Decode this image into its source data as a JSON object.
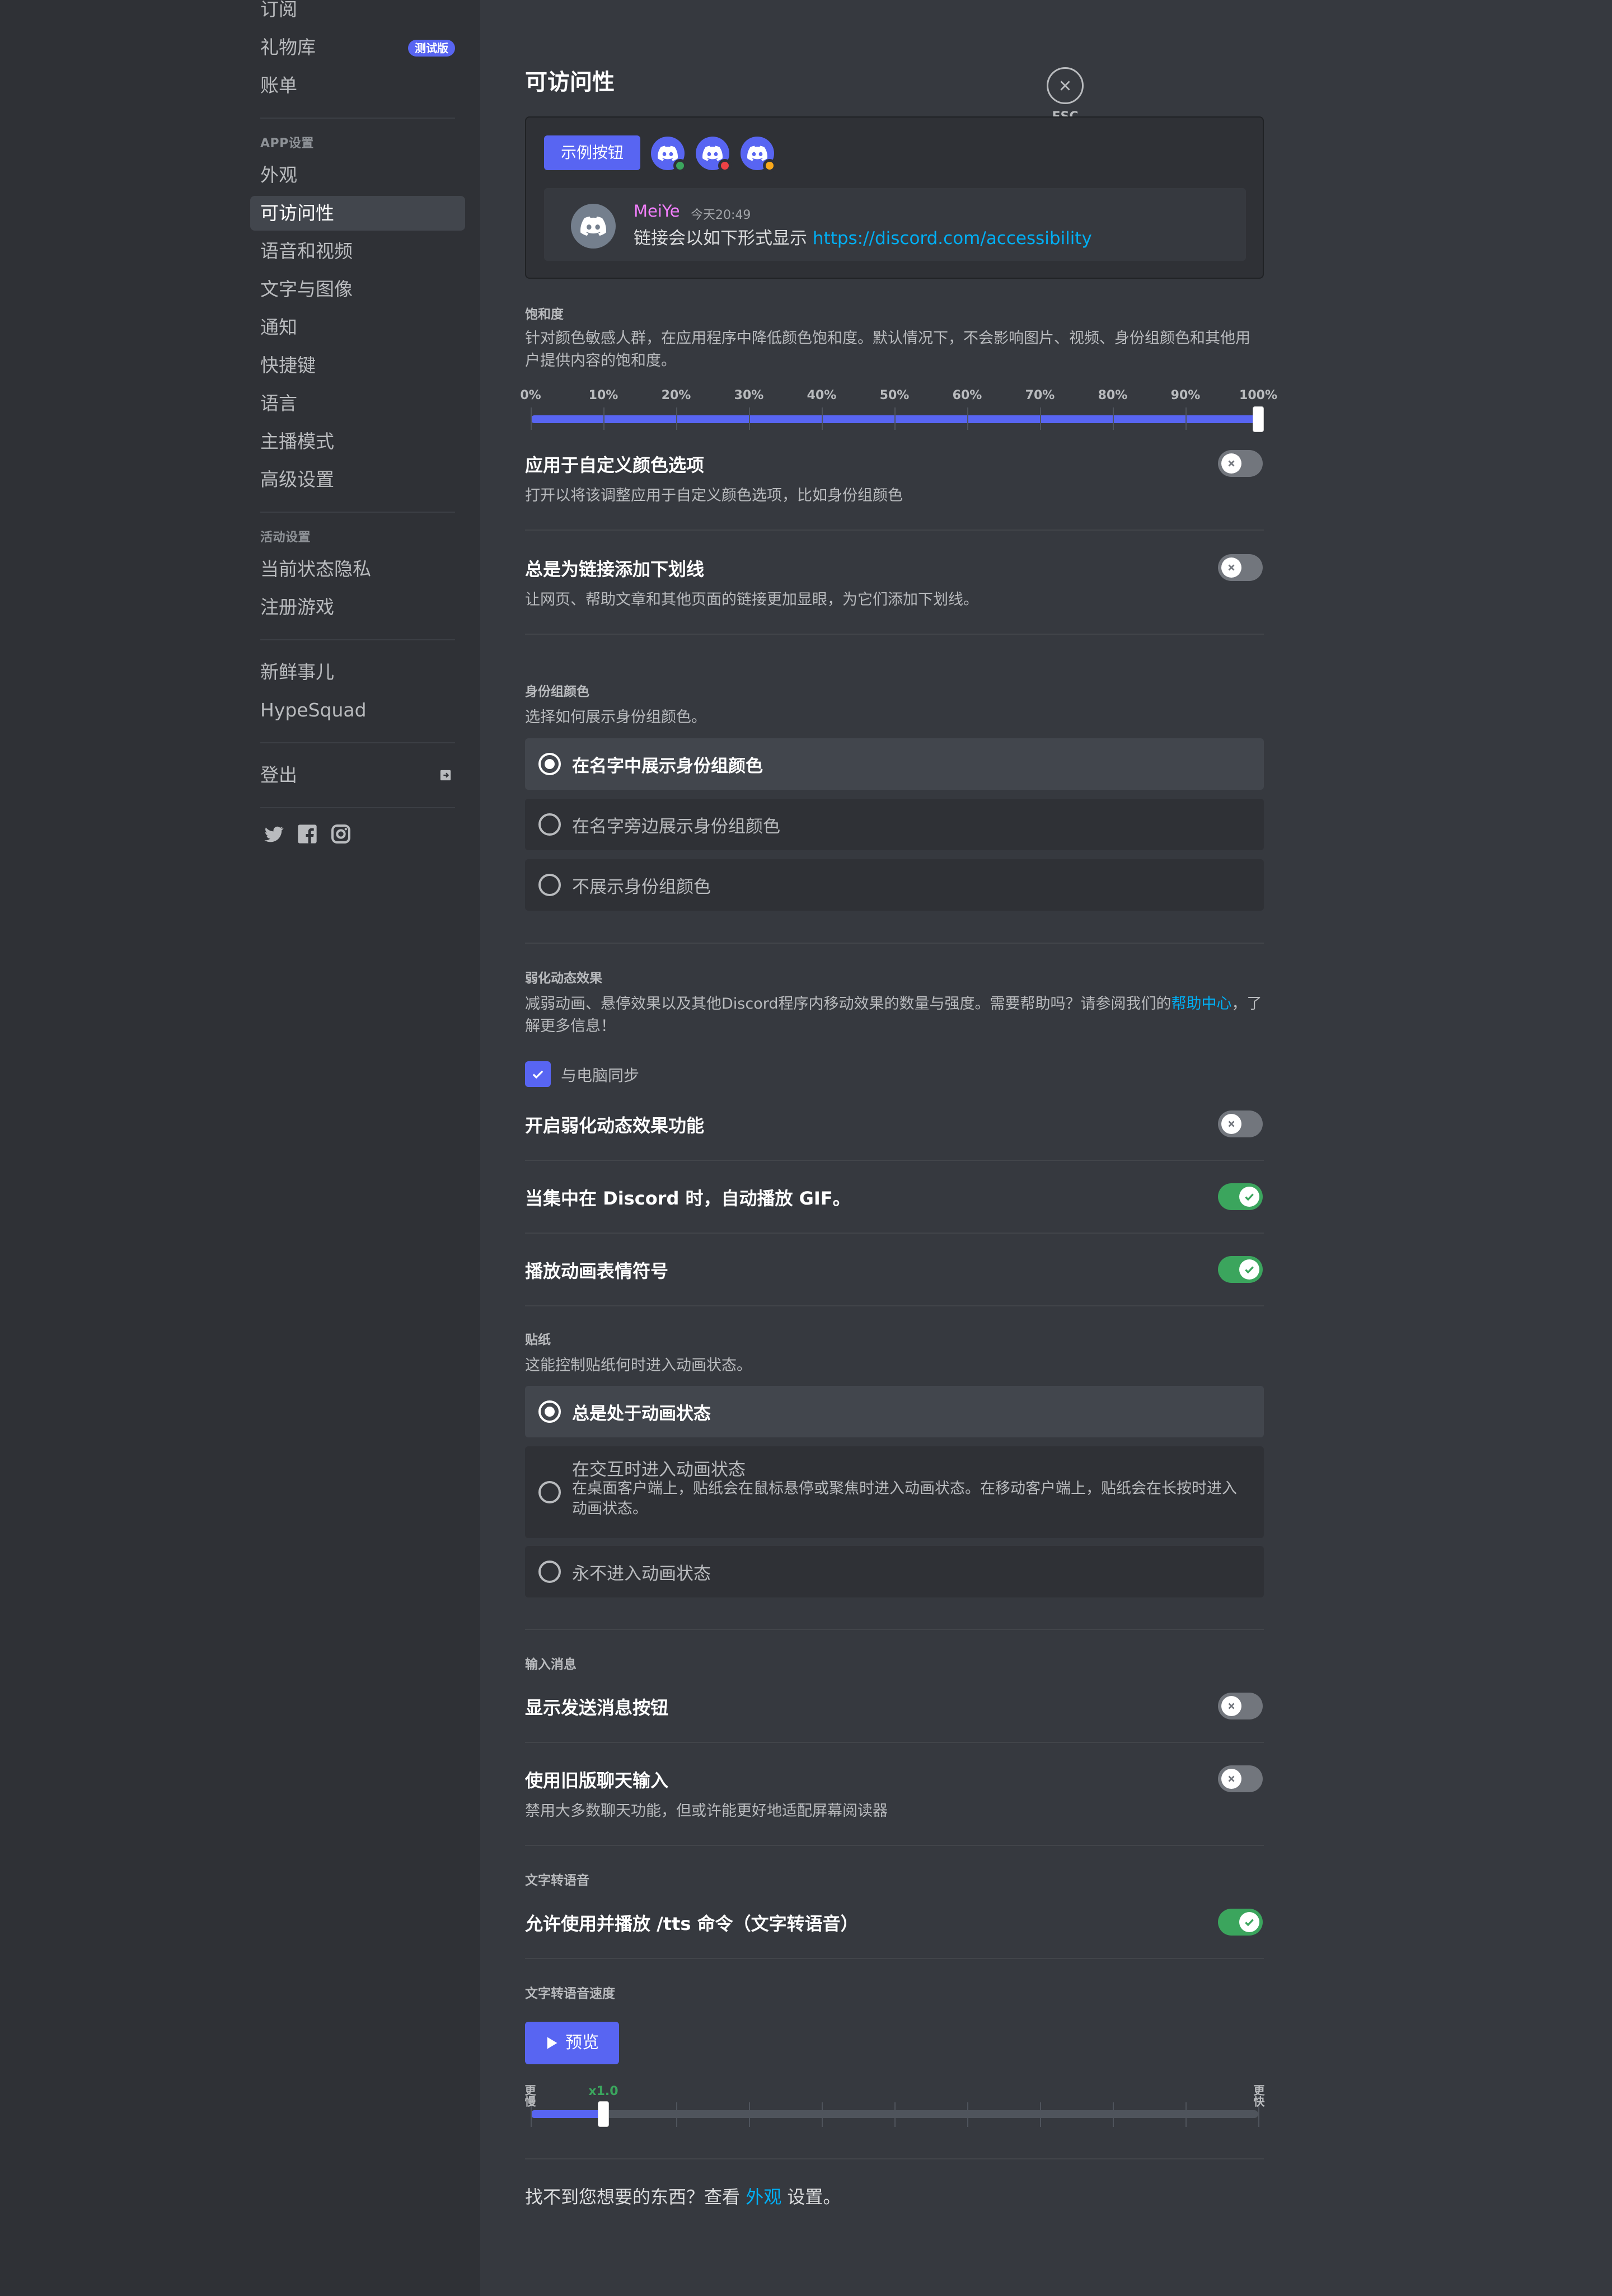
{
  "sidebar": {
    "items_top": [
      {
        "label": "订阅"
      },
      {
        "label": "礼物库",
        "badge": "测试版"
      },
      {
        "label": "账单"
      }
    ],
    "app_settings_header": "APP设置",
    "app_items": [
      {
        "label": "外观"
      },
      {
        "label": "可访问性",
        "active": true
      },
      {
        "label": "语音和视频"
      },
      {
        "label": "文字与图像"
      },
      {
        "label": "通知"
      },
      {
        "label": "快捷键"
      },
      {
        "label": "语言"
      },
      {
        "label": "主播模式"
      },
      {
        "label": "高级设置"
      }
    ],
    "activity_header": "活动设置",
    "activity_items": [
      {
        "label": "当前状态隐私"
      },
      {
        "label": "注册游戏"
      }
    ],
    "misc_items": [
      {
        "label": "新鲜事儿"
      },
      {
        "label": "HypeSquad"
      }
    ],
    "logout_label": "登出",
    "socials": [
      "twitter-icon",
      "facebook-icon",
      "instagram-icon"
    ]
  },
  "header": {
    "title": "可访问性",
    "esc_label": "ESC"
  },
  "preview": {
    "demo_button": "示例按钮",
    "avatars": [
      {
        "status": "online",
        "color": "#3ba55d"
      },
      {
        "status": "dnd",
        "color": "#ed4245"
      },
      {
        "status": "idle",
        "color": "#faa81a"
      }
    ],
    "message": {
      "name": "MeiYe",
      "time": "今天20:49",
      "text": "链接会以如下形式显示 ",
      "link": "https://discord.com/accessibility"
    }
  },
  "saturation": {
    "label": "饱和度",
    "description": "针对颜色敏感人群，在应用程序中降低颜色饱和度。默认情况下，不会影响图片、视频、身份组颜色和其他用户提供内容的饱和度。",
    "ticks": [
      "0%",
      "10%",
      "20%",
      "30%",
      "40%",
      "50%",
      "60%",
      "70%",
      "80%",
      "90%",
      "100%"
    ],
    "value": 1.0
  },
  "custom_colors": {
    "title": "应用于自定义颜色选项",
    "description": "打开以将该调整应用于自定义颜色选项，比如身份组颜色",
    "enabled": false
  },
  "underline_links": {
    "title": "总是为链接添加下划线",
    "description": "让网页、帮助文章和其他页面的链接更加显眼，为它们添加下划线。",
    "enabled": false
  },
  "role_colors": {
    "label": "身份组颜色",
    "description": "选择如何展示身份组颜色。",
    "options": [
      {
        "label": "在名字中展示身份组颜色",
        "selected": true
      },
      {
        "label": "在名字旁边展示身份组颜色",
        "selected": false
      },
      {
        "label": "不展示身份组颜色",
        "selected": false
      }
    ]
  },
  "reduced_motion": {
    "label": "弱化动态效果",
    "description": "减弱动画、悬停效果以及其他Discord程序内移动效果的数量与强度。需要帮助吗？请参阅我们的",
    "help_link": "帮助中心",
    "description_end": "，了解更多信息！",
    "sync_label": "与电脑同步",
    "sync_checked": true,
    "enable_title": "开启弱化动态效果功能",
    "enable_value": false,
    "gif_title": "当集中在 Discord 时，自动播放 GIF。",
    "gif_value": true,
    "emoji_title": "播放动画表情符号",
    "emoji_value": true
  },
  "stickers": {
    "label": "贴纸",
    "description": "这能控制贴纸何时进入动画状态。",
    "options": [
      {
        "label": "总是处于动画状态",
        "selected": true
      },
      {
        "label": "在交互时进入动画状态",
        "sub": "在桌面客户端上，贴纸会在鼠标悬停或聚焦时进入动画状态。在移动客户端上，贴纸会在长按时进入动画状态。",
        "selected": false
      },
      {
        "label": "永不进入动画状态",
        "selected": false
      }
    ]
  },
  "chat_input": {
    "label": "输入消息",
    "send_button_title": "显示发送消息按钮",
    "send_button_value": false,
    "legacy_title": "使用旧版聊天输入",
    "legacy_description": "禁用大多数聊天功能，但或许能更好地适配屏幕阅读器",
    "legacy_value": false
  },
  "tts": {
    "label": "文字转语音",
    "allow_title": "允许使用并播放 /tts 命令（文字转语音）",
    "allow_value": true,
    "rate_label": "文字转语音速度",
    "preview_button": "预览",
    "rate_marker": "x1.0",
    "slow_label": "更慢",
    "fast_label": "更快",
    "rate_fraction": 0.1
  },
  "footer": {
    "text_before": "找不到您想要的东西？查看 ",
    "link": "外观",
    "text_after": " 设置。"
  },
  "colors": {
    "blurple": "#5865f2",
    "green": "#3ba55d",
    "link": "#00aff4"
  }
}
